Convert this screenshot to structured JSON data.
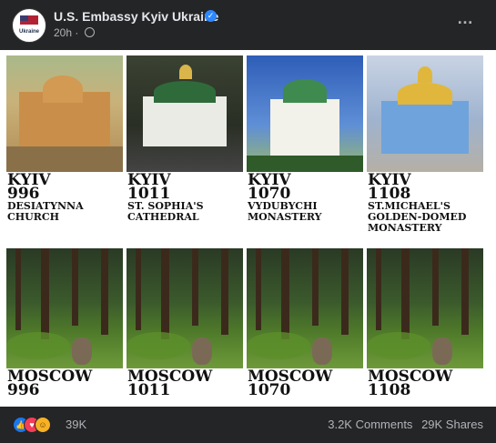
{
  "post": {
    "page_name": "U.S. Embassy Kyiv Ukraine",
    "avatar_text": "Ukraine",
    "time": "20h",
    "time_separator": "·",
    "more_icon": "…"
  },
  "image": {
    "kyiv_tiles": [
      {
        "city": "KYIV",
        "year": "996",
        "name_line1": "DESIATYNNA",
        "name_line2": "CHURCH",
        "name_line3": ""
      },
      {
        "city": "KYIV",
        "year": "1011",
        "name_line1": "ST. SOPHIA'S",
        "name_line2": "CATHEDRAL",
        "name_line3": ""
      },
      {
        "city": "KYIV",
        "year": "1070",
        "name_line1": "VYDUBYCHI",
        "name_line2": "MONASTERY",
        "name_line3": ""
      },
      {
        "city": "KYIV",
        "year": "1108",
        "name_line1": "ST.MICHAEL'S",
        "name_line2": "GOLDEN-DOMED",
        "name_line3": "MONASTERY"
      }
    ],
    "moscow_tiles": [
      {
        "city": "MOSCOW",
        "year": "996"
      },
      {
        "city": "MOSCOW",
        "year": "1011"
      },
      {
        "city": "MOSCOW",
        "year": "1070"
      },
      {
        "city": "MOSCOW",
        "year": "1108"
      }
    ]
  },
  "footer": {
    "reactions": [
      "like-icon",
      "love-icon",
      "haha-icon"
    ],
    "reaction_count": "39K",
    "comments": "3.2K Comments",
    "shares": "29K Shares"
  },
  "colors": {
    "background": "#242526",
    "text_primary": "#e4e6eb",
    "text_secondary": "#b0b3b8",
    "verified": "#2d88ff",
    "like": "#1877f2",
    "love": "#f33e58",
    "haha": "#f7b125"
  }
}
